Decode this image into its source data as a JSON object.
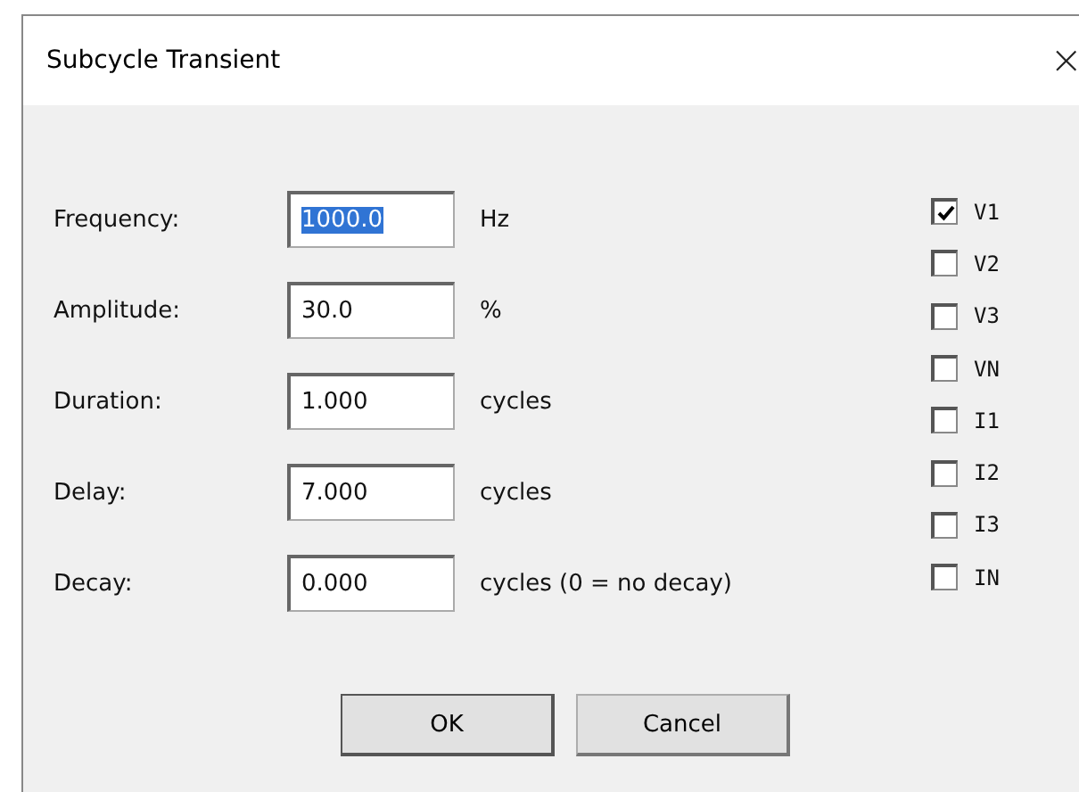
{
  "window": {
    "title": "Subcycle Transient",
    "close": "×"
  },
  "fields": [
    {
      "label": "Frequency:",
      "value": "1000.0",
      "unit": "Hz",
      "focused": true
    },
    {
      "label": "Amplitude:",
      "value": "30.0",
      "unit": "%",
      "focused": false
    },
    {
      "label": "Duration:",
      "value": "1.000",
      "unit": "cycles",
      "focused": false
    },
    {
      "label": "Delay:",
      "value": "7.000",
      "unit": "cycles",
      "focused": false
    },
    {
      "label": "Decay:",
      "value": "0.000",
      "unit": "cycles (0 = no decay)",
      "focused": false
    }
  ],
  "channels": [
    {
      "label": "V1",
      "checked": true
    },
    {
      "label": "V2",
      "checked": false
    },
    {
      "label": "V3",
      "checked": false
    },
    {
      "label": "VN",
      "checked": false
    },
    {
      "label": "I1",
      "checked": false
    },
    {
      "label": "I2",
      "checked": false
    },
    {
      "label": "I3",
      "checked": false
    },
    {
      "label": "IN",
      "checked": false
    }
  ],
  "buttons": [
    {
      "label": "OK",
      "default": true
    },
    {
      "label": "Cancel",
      "default": false
    }
  ]
}
